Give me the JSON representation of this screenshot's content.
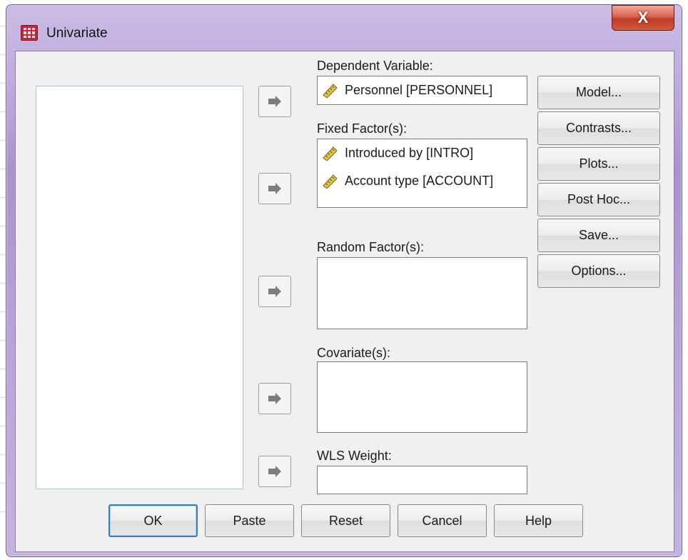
{
  "window": {
    "title": "Univariate",
    "close_glyph": "X",
    "app_icon": "table-grid-icon",
    "accent_color": "#b7a4d8"
  },
  "arrow_icon": "move-right-arrow-icon",
  "targets": {
    "dependent": {
      "label": "Dependent Variable:",
      "items": [
        {
          "icon": "scale-ruler-icon",
          "text": "Personnel [PERSONNEL]"
        }
      ]
    },
    "fixed": {
      "label": "Fixed Factor(s):",
      "items": [
        {
          "icon": "scale-ruler-icon",
          "text": "Introduced by [INTRO]"
        },
        {
          "icon": "scale-ruler-icon",
          "text": "Account type [ACCOUNT]"
        }
      ]
    },
    "random": {
      "label": "Random Factor(s):",
      "items": []
    },
    "covariates": {
      "label": "Covariate(s):",
      "items": []
    },
    "wls": {
      "label": "WLS Weight:",
      "value": ""
    }
  },
  "side_buttons": [
    "Model...",
    "Contrasts...",
    "Plots...",
    "Post Hoc...",
    "Save...",
    "Options..."
  ],
  "bottom_buttons": [
    "OK",
    "Paste",
    "Reset",
    "Cancel",
    "Help"
  ]
}
